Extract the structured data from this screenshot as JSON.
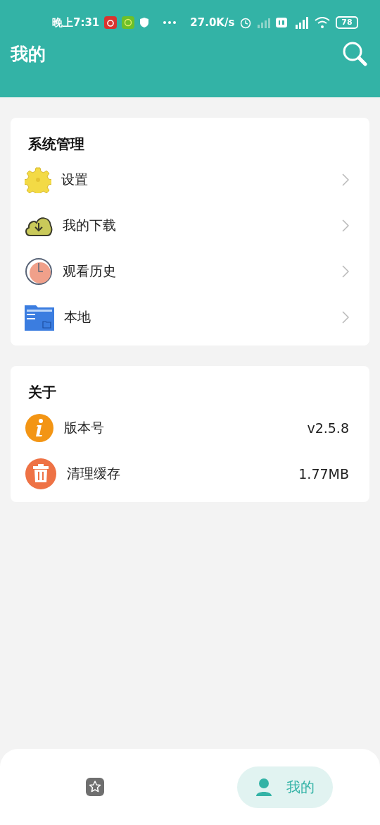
{
  "status_bar": {
    "time": "晚上7:31",
    "speed": "27.0K/s",
    "battery": "78"
  },
  "header": {
    "title": "我的"
  },
  "sections": [
    {
      "title": "系统管理",
      "items": [
        {
          "kind": "link",
          "label": "设置"
        },
        {
          "kind": "link",
          "label": "我的下载"
        },
        {
          "kind": "link",
          "label": "观看历史"
        },
        {
          "kind": "link",
          "label": "本地"
        }
      ]
    },
    {
      "title": "关于",
      "items": [
        {
          "kind": "value",
          "label": "版本号",
          "value": "v2.5.8"
        },
        {
          "kind": "value",
          "label": "清理缓存",
          "value": "1.77MB"
        }
      ]
    }
  ],
  "nav": [
    {
      "selected": false
    },
    {
      "selected": true,
      "label": "我的"
    }
  ]
}
